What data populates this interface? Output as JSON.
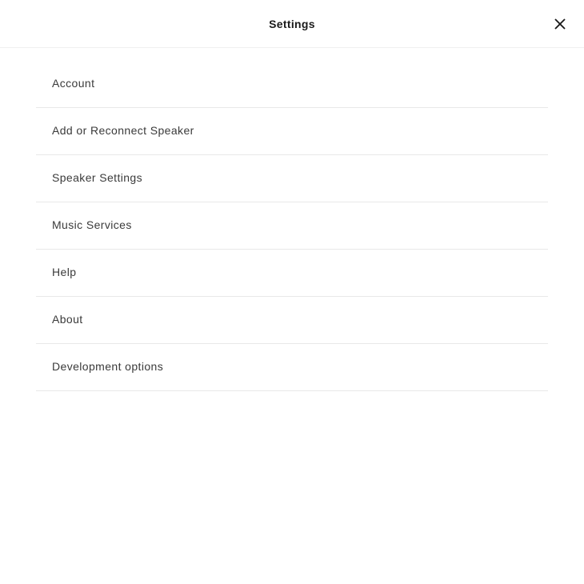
{
  "header": {
    "title": "Settings"
  },
  "menu": {
    "items": [
      {
        "label": "Account"
      },
      {
        "label": "Add or Reconnect Speaker"
      },
      {
        "label": "Speaker Settings"
      },
      {
        "label": "Music Services"
      },
      {
        "label": "Help"
      },
      {
        "label": "About"
      },
      {
        "label": "Development options"
      }
    ]
  }
}
